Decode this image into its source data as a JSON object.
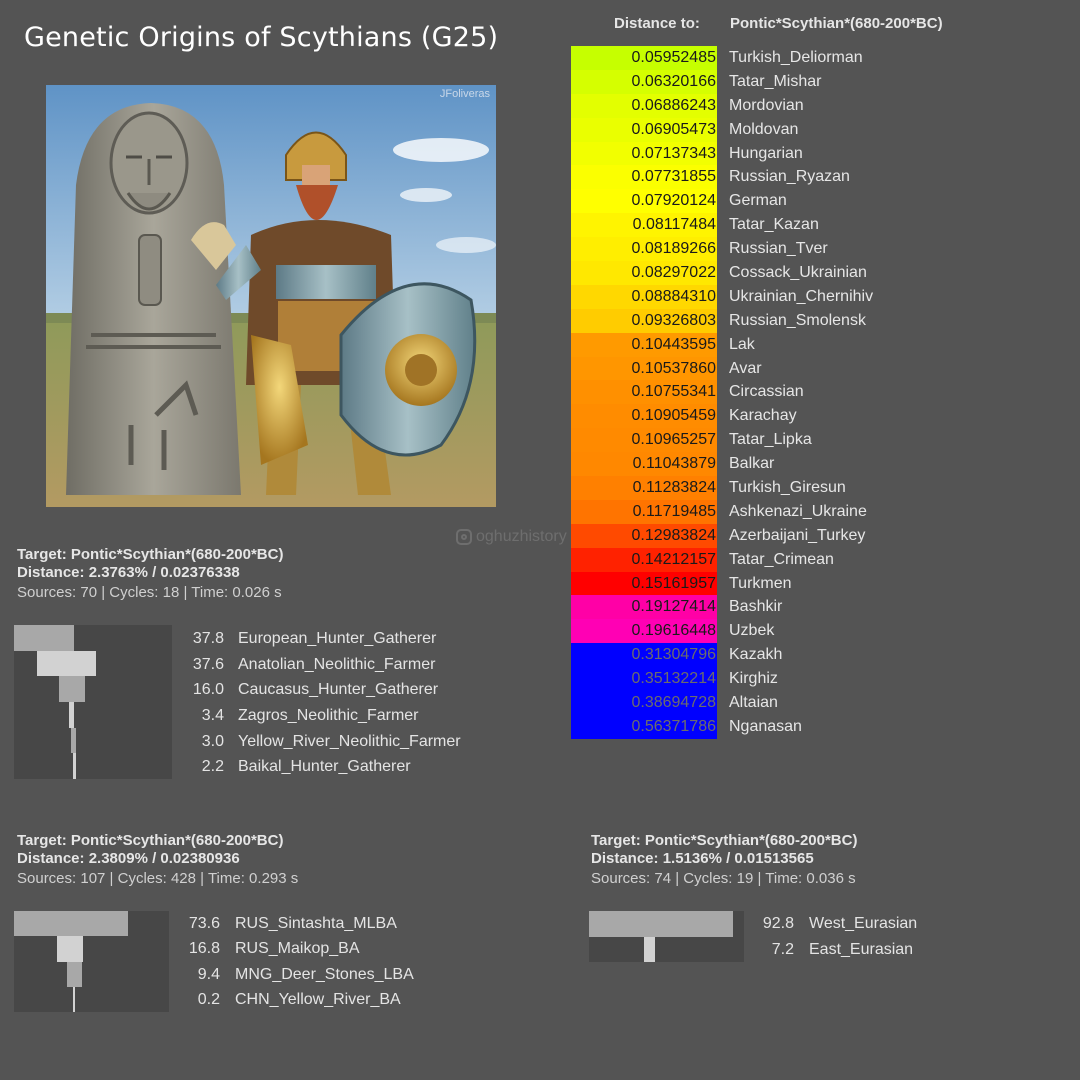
{
  "page": {
    "title": "Genetic Origins of Scythians (G25)"
  },
  "illustration": {
    "credit": "JFoliveras",
    "watermark": "oghuzhistory"
  },
  "distance": {
    "label": "Distance to:",
    "target": "Pontic*Scythian*(680-200*BC)",
    "rows": [
      {
        "value": "0.05952485",
        "name": "Turkish_Deliorman",
        "color": "#c6ff00",
        "text": "#1a1a1a"
      },
      {
        "value": "0.06320166",
        "name": "Tatar_Mishar",
        "color": "#d5ff00",
        "text": "#1a1a1a"
      },
      {
        "value": "0.06886243",
        "name": "Mordovian",
        "color": "#e3ff00",
        "text": "#1a1a1a"
      },
      {
        "value": "0.06905473",
        "name": "Moldovan",
        "color": "#eaff00",
        "text": "#1a1a1a"
      },
      {
        "value": "0.07137343",
        "name": "Hungarian",
        "color": "#f2ff00",
        "text": "#1a1a1a"
      },
      {
        "value": "0.07731855",
        "name": "Russian_Ryazan",
        "color": "#fbff00",
        "text": "#1a1a1a"
      },
      {
        "value": "0.07920124",
        "name": "German",
        "color": "#ffff00",
        "text": "#1a1a1a"
      },
      {
        "value": "0.08117484",
        "name": "Tatar_Kazan",
        "color": "#fff400",
        "text": "#1a1a1a"
      },
      {
        "value": "0.08189266",
        "name": "Russian_Tver",
        "color": "#ffee00",
        "text": "#1a1a1a"
      },
      {
        "value": "0.08297022",
        "name": "Cossack_Ukrainian",
        "color": "#ffe800",
        "text": "#1a1a1a"
      },
      {
        "value": "0.08884310",
        "name": "Ukrainian_Chernihiv",
        "color": "#ffd800",
        "text": "#1a1a1a"
      },
      {
        "value": "0.09326803",
        "name": "Russian_Smolensk",
        "color": "#ffcc00",
        "text": "#1a1a1a"
      },
      {
        "value": "0.10443595",
        "name": "Lak",
        "color": "#ff9a00",
        "text": "#1a1a1a"
      },
      {
        "value": "0.10537860",
        "name": "Avar",
        "color": "#ff9600",
        "text": "#1a1a1a"
      },
      {
        "value": "0.10755341",
        "name": "Circassian",
        "color": "#ff9000",
        "text": "#1a1a1a"
      },
      {
        "value": "0.10905459",
        "name": "Karachay",
        "color": "#ff8c00",
        "text": "#1a1a1a"
      },
      {
        "value": "0.10965257",
        "name": "Tatar_Lipka",
        "color": "#ff8a00",
        "text": "#1a1a1a"
      },
      {
        "value": "0.11043879",
        "name": "Balkar",
        "color": "#ff8800",
        "text": "#1a1a1a"
      },
      {
        "value": "0.11283824",
        "name": "Turkish_Giresun",
        "color": "#ff8000",
        "text": "#1a1a1a"
      },
      {
        "value": "0.11719485",
        "name": "Ashkenazi_Ukraine",
        "color": "#ff7400",
        "text": "#1a1a1a"
      },
      {
        "value": "0.12983824",
        "name": "Azerbaijani_Turkey",
        "color": "#ff4a00",
        "text": "#1a1a1a"
      },
      {
        "value": "0.14212157",
        "name": "Tatar_Crimean",
        "color": "#ff2200",
        "text": "#1a1a1a"
      },
      {
        "value": "0.15161957",
        "name": "Turkmen",
        "color": "#ff0000",
        "text": "#1a1a1a"
      },
      {
        "value": "0.19127414",
        "name": "Bashkir",
        "color": "#ff00a6",
        "text": "#1a1a1a"
      },
      {
        "value": "0.19616448",
        "name": "Uzbek",
        "color": "#ff00b4",
        "text": "#1a1a1a"
      },
      {
        "value": "0.31304796",
        "name": "Kazakh",
        "color": "#0000ff",
        "text": "#6c6c6c"
      },
      {
        "value": "0.35132214",
        "name": "Kirghiz",
        "color": "#0000ff",
        "text": "#6c6c6c"
      },
      {
        "value": "0.38694728",
        "name": "Altaian",
        "color": "#0000ff",
        "text": "#6c6c6c"
      },
      {
        "value": "0.56371786",
        "name": "Nganasan",
        "color": "#0000ff",
        "text": "#6c6c6c"
      }
    ]
  },
  "panels": [
    {
      "target": "Target: Pontic*Scythian*(680-200*BC)",
      "distance": "Distance: 2.3763% / 0.02376338",
      "meta": "Sources: 70 | Cycles: 18 | Time: 0.026 s",
      "components": [
        {
          "value": "37.8",
          "name": "European_Hunter_Gatherer"
        },
        {
          "value": "37.6",
          "name": "Anatolian_Neolithic_Farmer"
        },
        {
          "value": "16.0",
          "name": "Caucasus_Hunter_Gatherer"
        },
        {
          "value": "3.4",
          "name": "Zagros_Neolithic_Farmer"
        },
        {
          "value": "3.0",
          "name": "Yellow_River_Neolithic_Farmer"
        },
        {
          "value": "2.2",
          "name": "Baikal_Hunter_Gatherer"
        }
      ]
    },
    {
      "target": "Target: Pontic*Scythian*(680-200*BC)",
      "distance": "Distance: 2.3809% / 0.02380936",
      "meta": "Sources: 107 | Cycles: 428 | Time: 0.293 s",
      "components": [
        {
          "value": "73.6",
          "name": "RUS_Sintashta_MLBA"
        },
        {
          "value": "16.8",
          "name": "RUS_Maikop_BA"
        },
        {
          "value": "9.4",
          "name": "MNG_Deer_Stones_LBA"
        },
        {
          "value": "0.2",
          "name": "CHN_Yellow_River_BA"
        }
      ]
    },
    {
      "target": "Target: Pontic*Scythian*(680-200*BC)",
      "distance": "Distance: 1.5136% / 0.01513565",
      "meta": "Sources: 74 | Cycles: 19 | Time: 0.036 s",
      "components": [
        {
          "value": "92.8",
          "name": "West_Eurasian"
        },
        {
          "value": "7.2",
          "name": "East_Eurasian"
        }
      ]
    }
  ],
  "chart_data": [
    {
      "type": "table",
      "title": "Distance to: Pontic*Scythian*(680-200*BC)",
      "columns": [
        "distance",
        "population"
      ],
      "categories": [
        "Turkish_Deliorman",
        "Tatar_Mishar",
        "Mordovian",
        "Moldovan",
        "Hungarian",
        "Russian_Ryazan",
        "German",
        "Tatar_Kazan",
        "Russian_Tver",
        "Cossack_Ukrainian",
        "Ukrainian_Chernihiv",
        "Russian_Smolensk",
        "Lak",
        "Avar",
        "Circassian",
        "Karachay",
        "Tatar_Lipka",
        "Balkar",
        "Turkish_Giresun",
        "Ashkenazi_Ukraine",
        "Azerbaijani_Turkey",
        "Tatar_Crimean",
        "Turkmen",
        "Bashkir",
        "Uzbek",
        "Kazakh",
        "Kirghiz",
        "Altaian",
        "Nganasan"
      ],
      "values": [
        0.05952485,
        0.06320166,
        0.06886243,
        0.06905473,
        0.07137343,
        0.07731855,
        0.07920124,
        0.08117484,
        0.08189266,
        0.08297022,
        0.0888431,
        0.09326803,
        0.10443595,
        0.1053786,
        0.10755341,
        0.10905459,
        0.10965257,
        0.11043879,
        0.11283824,
        0.11719485,
        0.12983824,
        0.14212157,
        0.15161957,
        0.19127414,
        0.19616448,
        0.31304796,
        0.35132214,
        0.38694728,
        0.56371786
      ]
    },
    {
      "type": "bar",
      "title": "Target: Pontic*Scythian*(680-200*BC)",
      "categories": [
        "European_Hunter_Gatherer",
        "Anatolian_Neolithic_Farmer",
        "Caucasus_Hunter_Gatherer",
        "Zagros_Neolithic_Farmer",
        "Yellow_River_Neolithic_Farmer",
        "Baikal_Hunter_Gatherer"
      ],
      "values": [
        37.8,
        37.6,
        16.0,
        3.4,
        3.0,
        2.2
      ],
      "ylim": [
        0,
        100
      ]
    },
    {
      "type": "bar",
      "title": "Target: Pontic*Scythian*(680-200*BC)",
      "categories": [
        "RUS_Sintashta_MLBA",
        "RUS_Maikop_BA",
        "MNG_Deer_Stones_LBA",
        "CHN_Yellow_River_BA"
      ],
      "values": [
        73.6,
        16.8,
        9.4,
        0.2
      ],
      "ylim": [
        0,
        100
      ]
    },
    {
      "type": "bar",
      "title": "Target: Pontic*Scythian*(680-200*BC)",
      "categories": [
        "West_Eurasian",
        "East_Eurasian"
      ],
      "values": [
        92.8,
        7.2
      ],
      "ylim": [
        0,
        100
      ]
    }
  ]
}
